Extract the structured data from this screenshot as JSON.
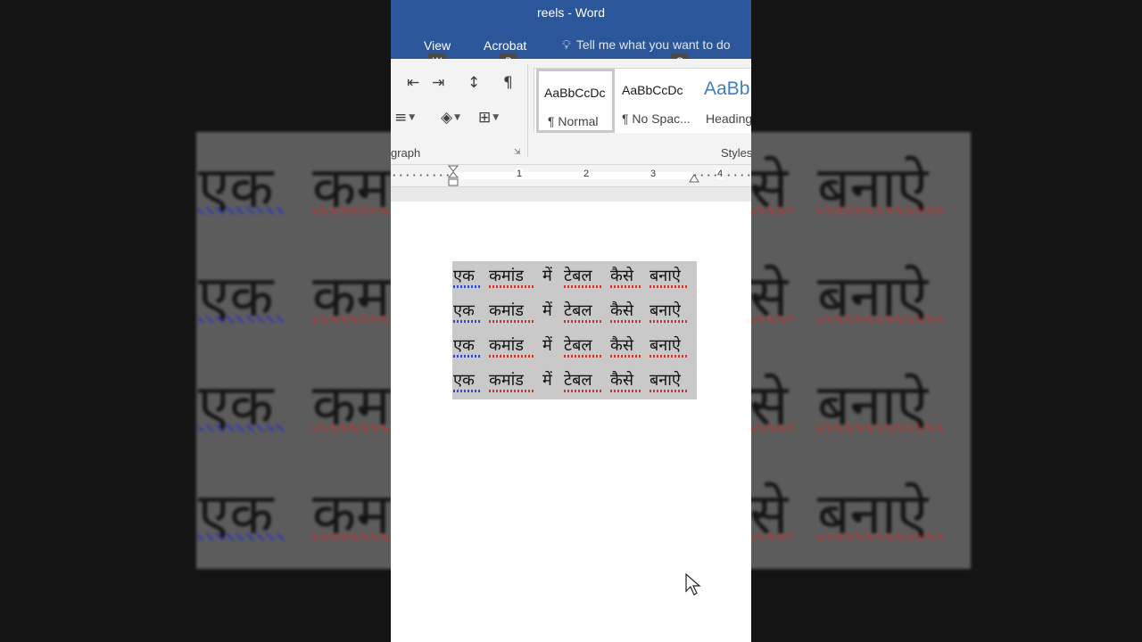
{
  "window": {
    "title": "reels - Word"
  },
  "menu": {
    "tabs": [
      {
        "label": "View"
      },
      {
        "label": "Acrobat"
      }
    ],
    "tell_me": "Tell me what you want to do"
  },
  "keytips": [
    "W",
    "B",
    "Q"
  ],
  "ribbon": {
    "paragraph_group_label": "graph",
    "styles_group_label": "Styles",
    "styles": [
      {
        "sample": "AaBbCcDc",
        "name": "¶ Normal",
        "selected": true
      },
      {
        "sample": "AaBbCcDc",
        "name": "¶ No Spac...",
        "selected": false
      },
      {
        "sample": "AaBb",
        "name": "Heading",
        "selected": false
      }
    ]
  },
  "ruler": {
    "numbers": [
      "1",
      "2",
      "3",
      "4"
    ]
  },
  "document": {
    "lines": [
      [
        "एक",
        "कमांड",
        "में",
        "टेबल",
        "कैसे",
        "बनाऐ"
      ],
      [
        "एक",
        "कमांड",
        "में",
        "टेबल",
        "कैसे",
        "बनाऐ"
      ],
      [
        "एक",
        "कमांड",
        "में",
        "टेबल",
        "कैसे",
        "बनाऐ"
      ],
      [
        "एक",
        "कमांड",
        "में",
        "टेबल",
        "कैसे",
        "बनाऐ"
      ]
    ]
  },
  "background_zoom": {
    "left_words": [
      "एक",
      "कम"
    ],
    "right_words": [
      "से",
      "बनाऐ"
    ]
  },
  "colors": {
    "title_bar": "#2b579a",
    "spell_error": "#d0342c",
    "grammar_error": "#2d4bd0",
    "selection": "#c9c9c9"
  }
}
